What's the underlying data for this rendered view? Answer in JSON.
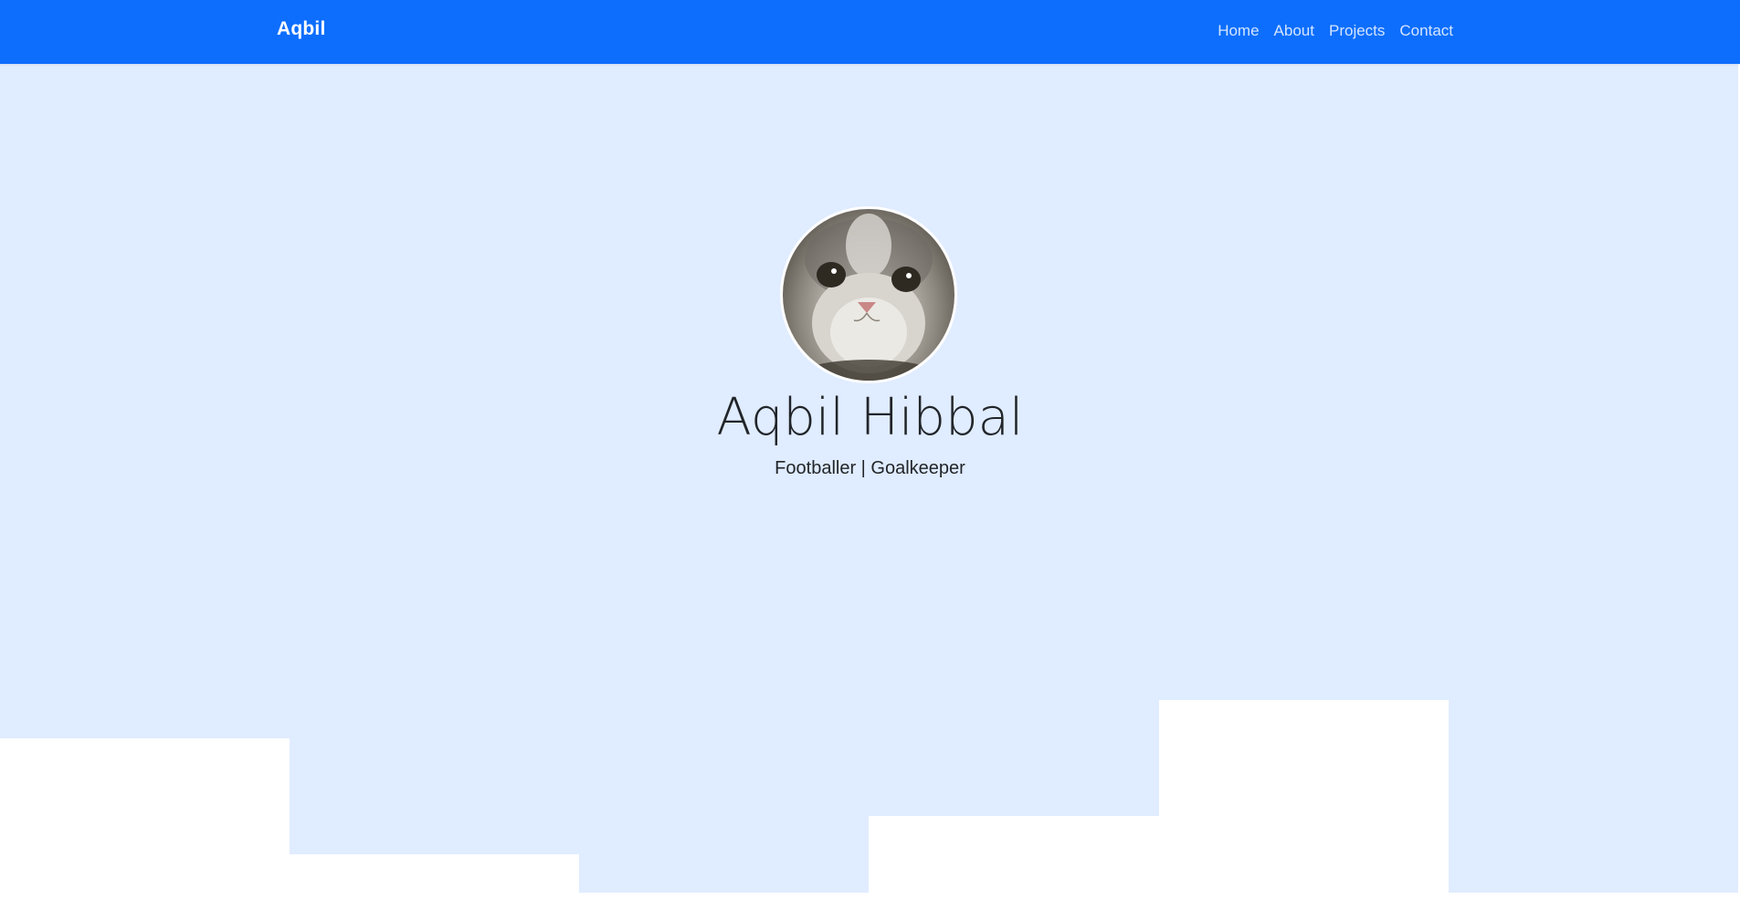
{
  "navbar": {
    "brand": "Aqbil",
    "links": [
      "Home",
      "About",
      "Projects",
      "Contact"
    ],
    "background_color": "#0d6efd"
  },
  "hero": {
    "avatar_icon": "cat-photo-avatar",
    "name": "Aqbil Hibbal",
    "subtitle": "Footballer | Goalkeeper",
    "background_color": "#e0ecff"
  }
}
